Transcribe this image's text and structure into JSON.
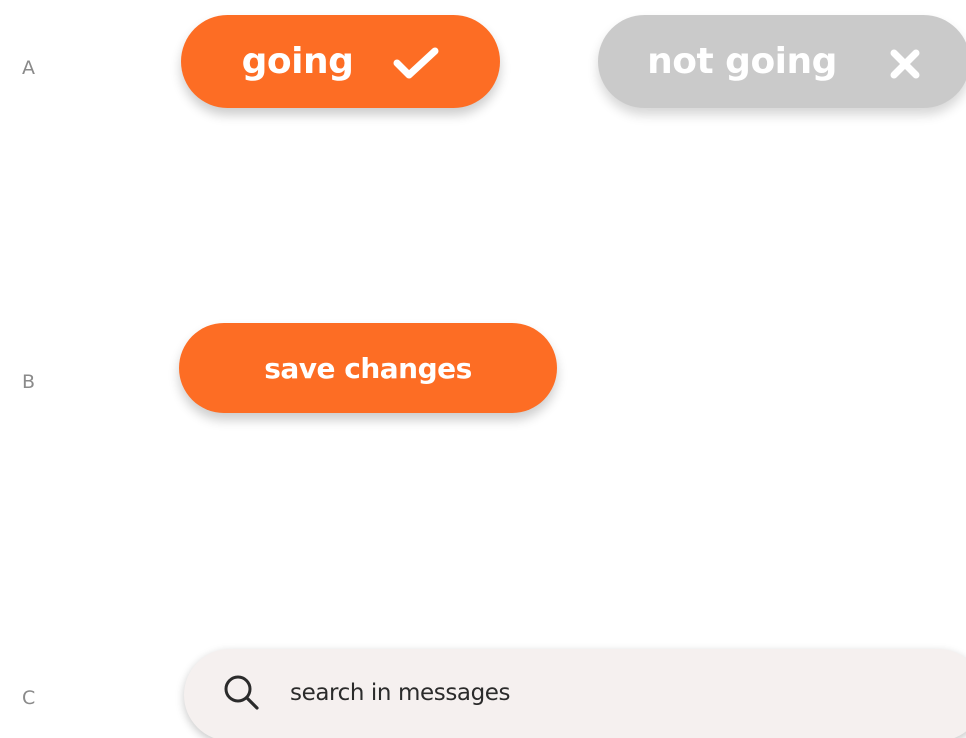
{
  "rows": {
    "a_label": "A",
    "b_label": "B",
    "c_label": "C"
  },
  "rsvp": {
    "going_label": "going",
    "going_icon": "checkmark-icon",
    "not_going_label": "not going",
    "not_going_icon": "close-icon"
  },
  "form": {
    "save_label": "save changes"
  },
  "search": {
    "placeholder": "search in messages",
    "value": "",
    "icon": "search-icon"
  },
  "colors": {
    "accent": "#fd6d24",
    "inactive": "#cacaca",
    "search_bg": "#f5f0ef",
    "label": "#8a8a8a",
    "text_dark": "#2b2b2b"
  }
}
